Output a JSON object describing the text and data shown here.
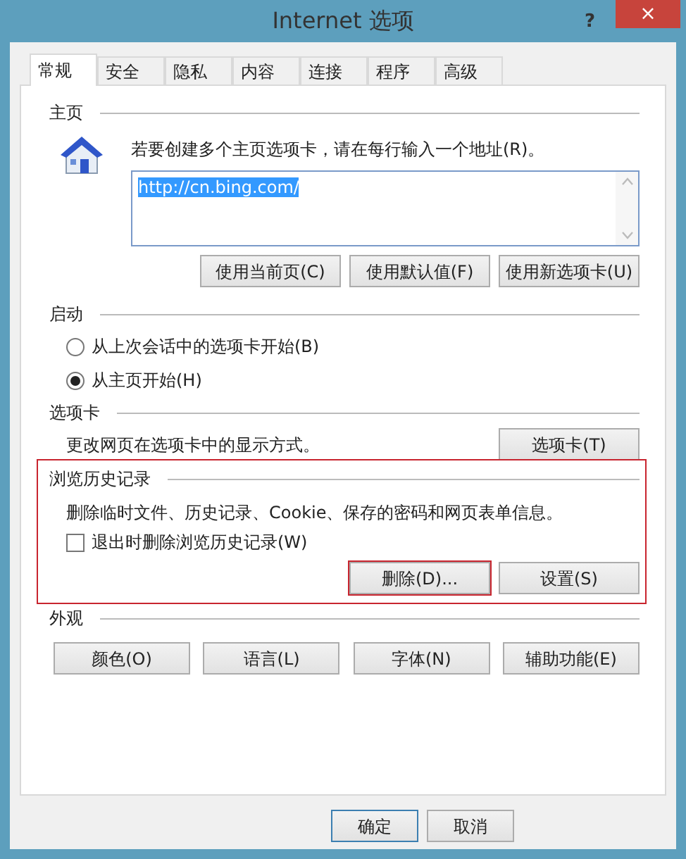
{
  "window": {
    "title": "Internet 选项",
    "help": "?",
    "close": "×"
  },
  "tabs": [
    {
      "label": "常规",
      "selected": true
    },
    {
      "label": "安全",
      "selected": false
    },
    {
      "label": "隐私",
      "selected": false
    },
    {
      "label": "内容",
      "selected": false
    },
    {
      "label": "连接",
      "selected": false
    },
    {
      "label": "程序",
      "selected": false
    },
    {
      "label": "高级",
      "selected": false
    }
  ],
  "home": {
    "heading": "主页",
    "instruction": "若要创建多个主页选项卡，请在每行输入一个地址(R)。",
    "value": "http://cn.bing.com/",
    "value_selected": true,
    "buttons": [
      "使用当前页(C)",
      "使用默认值(F)",
      "使用新选项卡(U)"
    ]
  },
  "startup": {
    "heading": "启动",
    "options": [
      {
        "label": "从上次会话中的选项卡开始(B)",
        "selected": false
      },
      {
        "label": "从主页开始(H)",
        "selected": true
      }
    ]
  },
  "tabs_section": {
    "heading": "选项卡",
    "description": "更改网页在选项卡中的显示方式。",
    "button": "选项卡(T)"
  },
  "history": {
    "heading": "浏览历史记录",
    "highlighted": true,
    "description": "删除临时文件、历史记录、Cookie、保存的密码和网页表单信息。",
    "checkbox": {
      "label": "退出时删除浏览历史记录(W)",
      "checked": false
    },
    "buttons": [
      {
        "label": "删除(D)...",
        "highlighted": true
      },
      {
        "label": "设置(S)",
        "highlighted": false
      }
    ]
  },
  "appearance": {
    "heading": "外观",
    "buttons": [
      "颜色(O)",
      "语言(L)",
      "字体(N)",
      "辅助功能(E)"
    ]
  },
  "footer_buttons": [
    {
      "label": "确定",
      "default": true
    },
    {
      "label": "取消",
      "default": false
    }
  ]
}
